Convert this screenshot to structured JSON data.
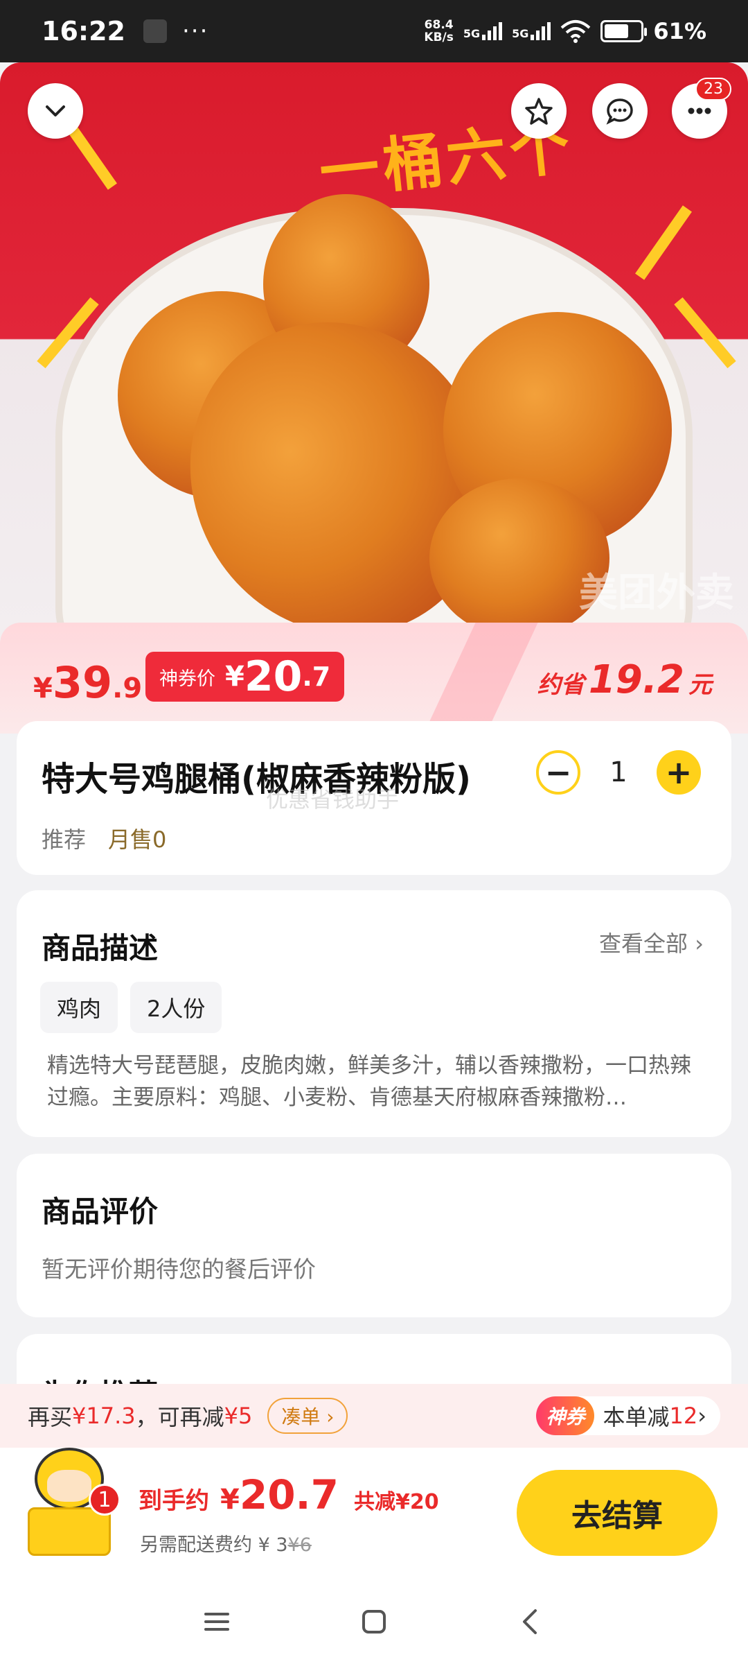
{
  "status": {
    "time": "16:22",
    "more": "···",
    "speed": "68.4\nKB/s",
    "speed_top": "68.4",
    "speed_bottom": "KB/s",
    "net1": "5G",
    "net2": "5G",
    "battery": "61%"
  },
  "hero": {
    "slogan": "一桶六个",
    "cart_badge": "23",
    "watermark": "美团外卖"
  },
  "price": {
    "original_currency": "¥",
    "original_int": "39",
    "original_dec": ".9",
    "coupon_label": "神券价",
    "coupon_currency": "¥",
    "coupon_int": "20",
    "coupon_dec": ".7",
    "save_prefix": "约省",
    "save_amount": "19.2",
    "save_unit": "元"
  },
  "product": {
    "title": "特大号鸡腿桶(椒麻香辣粉版)",
    "quantity": "1",
    "minus": "−",
    "plus": "+",
    "tag_recommend": "推荐",
    "monthly_sales": "月售0",
    "overlay_text": "优惠省钱助手"
  },
  "description": {
    "title": "商品描述",
    "see_all": "查看全部 ›",
    "tags": [
      "鸡肉",
      "2人份"
    ],
    "text": "精选特大号琵琶腿，皮脆肉嫩，鲜美多汁，辅以香辣撒粉，一口热辣过瘾。主要原料：鸡腿、小麦粉、肯德基天府椒麻香辣撒粉…"
  },
  "reviews": {
    "title": "商品评价",
    "empty": "暂无评价期待您的餐后评价"
  },
  "recommend": {
    "title": "为你推荐"
  },
  "promo": {
    "buy_more_prefix": "再买",
    "buy_more_amount": "¥17.3",
    "discount_prefix": "，可再减",
    "discount_amount": "¥5",
    "couple_button": "凑单 ›",
    "shen_badge": "神券",
    "order_discount_label": "本单减",
    "order_discount_value": "12",
    "chevron": "›"
  },
  "checkout": {
    "cart_count": "1",
    "final_label": "到手约",
    "final_currency": "¥",
    "final_value": "20.7",
    "total_saved": "共减¥20",
    "delivery_label": "另需配送费约 ¥ 3",
    "delivery_original": "¥6",
    "pay_button": "去结算"
  },
  "colors": {
    "accent_red": "#ea2a2a",
    "accent_yellow": "#ffd11a",
    "hero_red": "#d91b2c"
  },
  "icons": {
    "collapse": "chevron-down-icon",
    "favorite": "star-icon",
    "chat": "chat-bubble-icon",
    "more": "more-dots-icon",
    "nav_menu": "menu-lines-icon",
    "nav_home": "square-home-icon",
    "nav_back": "back-chevron-icon"
  }
}
